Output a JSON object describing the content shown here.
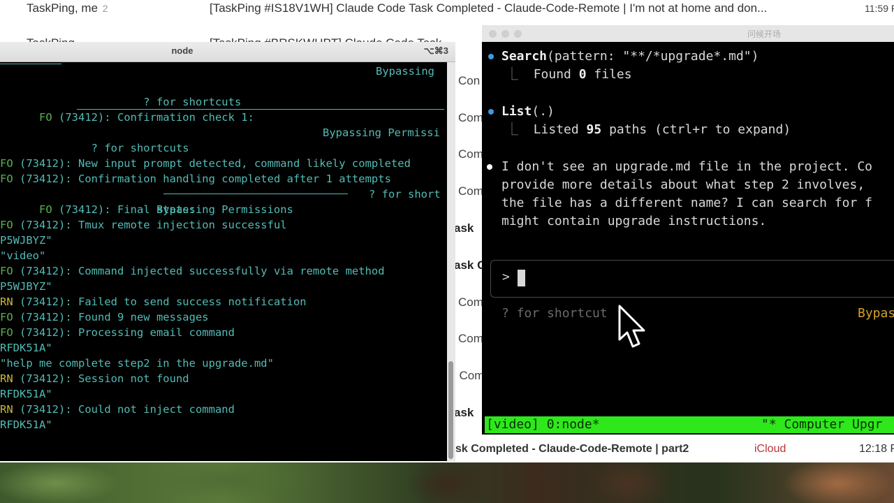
{
  "mail": {
    "top_row": {
      "sender": "TaskPing, me",
      "count": "2",
      "subject": "[TaskPing #IS18V1WH] Claude Code Task Completed - Claude-Code-Remote | I'm not at home and don...",
      "time": "11:59 PM"
    },
    "second_row": {
      "sender": "TaskPing",
      "subject": "[TaskPing #BRSKWHPT] Claude Code Task"
    },
    "fragments": [
      "Con",
      "Com",
      "Com",
      "Com",
      "ask",
      "ask C",
      "Com",
      "Com",
      ": Com",
      "ask"
    ],
    "bottom_row": {
      "text": "sk Completed - Claude-Code-Remote | part2",
      "source": "iCloud",
      "time": "12:18 P"
    }
  },
  "left_terminal": {
    "title": "node",
    "shortcut": "⌥⌘3",
    "lines": [
      {
        "plain": "                ? for shortcuts",
        "right": "Bypassing"
      },
      {
        "level": "FO",
        "text": " (73412): Confirmation check 1:"
      },
      {
        "plain": "        ? for shortcuts",
        "right": "Bypassing Permissi"
      },
      {
        "level": "FO",
        "text": " (73412): New input prompt detected, command likely completed"
      },
      {
        "level": "FO",
        "text": " (73412): Confirmation handling completed after 1 attempts"
      },
      {
        "level": "FO",
        "text": " (73412): Final state:",
        "right": "? for short"
      },
      {
        "plain": "                        Bypassing Permissions"
      },
      {
        "level": "FO",
        "text": " (73412): Tmux remote injection successful"
      },
      {
        "plain": "P5WJBYZ\""
      },
      {
        "plain": "\"video\""
      },
      {
        "level": "FO",
        "text": " (73412): Command injected successfully via remote method"
      },
      {
        "plain": "P5WJBYZ\""
      },
      {
        "level": "RN",
        "text": " (73412): Failed to send success notification"
      },
      {
        "level": "FO",
        "text": " (73412): Found 9 new messages"
      },
      {
        "level": "FO",
        "text": " (73412): Processing email command"
      },
      {
        "plain": "RFDK51A\""
      },
      {
        "plain": "\"help me complete step2 in the upgrade.md\""
      },
      {
        "level": "RN",
        "text": " (73412): Session not found"
      },
      {
        "plain": "RFDK51A\""
      },
      {
        "level": "RN",
        "text": " (73412): Could not inject command"
      },
      {
        "plain": "RFDK51A\""
      }
    ]
  },
  "right_terminal": {
    "title": "问候开场",
    "search": {
      "tool": "Search",
      "args": "(pattern: \"**/*upgrade*.md\")",
      "result_pre": "Found ",
      "result_num": "0",
      "result_post": " files"
    },
    "list": {
      "tool": "List",
      "args": "(.)",
      "result_pre": "Listed ",
      "result_num": "95",
      "result_post": " paths (ctrl+r to expand)"
    },
    "message_lines": [
      "I don't see an upgrade.md file in the project. Co",
      "provide more details about what step 2 involves,",
      "the file has a different name? I can search for f",
      "might contain upgrade instructions."
    ],
    "prompt": ">",
    "hint": "? for shortcut",
    "mode": "Bypas",
    "tmux_left": "[video] 0:node*",
    "tmux_right": "\"* Computer Upgr"
  },
  "colors": {
    "teal_text": "#52bcb6",
    "info_green": "#58b24e",
    "warn_yellow": "#c8b83a",
    "bullet_blue": "#3b9ae0",
    "tmux_green": "#2ee81c",
    "mode_yellow": "#d6a12a"
  },
  "icons": {
    "tree_branch": "⎿",
    "pointer": "mouse-pointer-icon"
  }
}
